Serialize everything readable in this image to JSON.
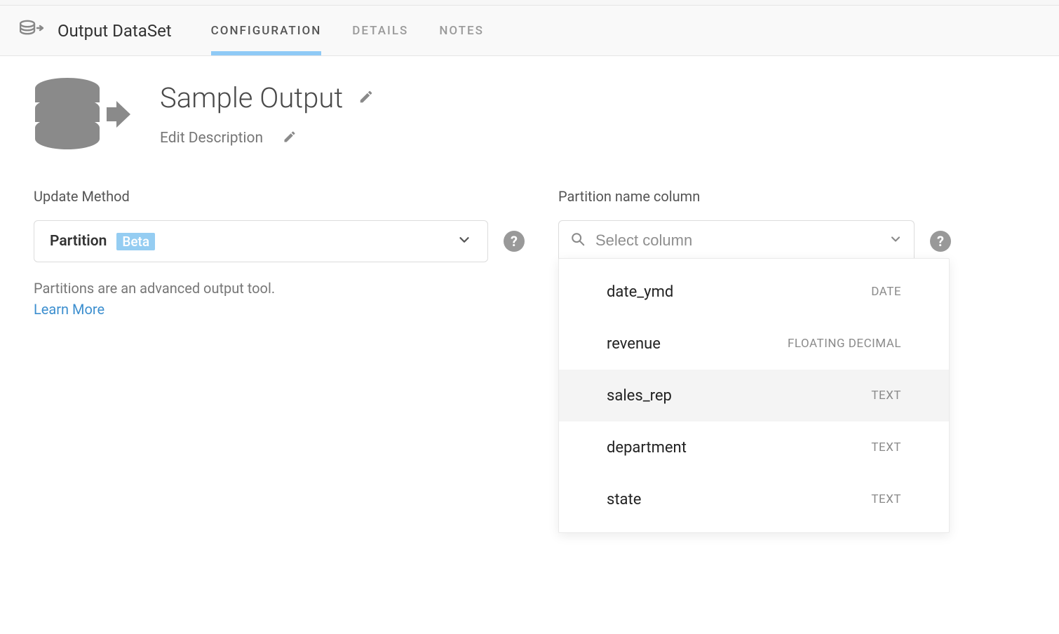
{
  "header": {
    "title": "Output DataSet",
    "tabs": [
      {
        "label": "CONFIGURATION",
        "active": true
      },
      {
        "label": "DETAILS",
        "active": false
      },
      {
        "label": "NOTES",
        "active": false
      }
    ]
  },
  "dataset": {
    "title": "Sample Output",
    "description_placeholder": "Edit Description"
  },
  "update_method": {
    "label": "Update Method",
    "value": "Partition",
    "badge": "Beta",
    "helper": "Partitions are an advanced output tool.",
    "learn_more": "Learn More"
  },
  "partition_column": {
    "label": "Partition name column",
    "placeholder": "Select column",
    "options": [
      {
        "name": "date_ymd",
        "type": "DATE"
      },
      {
        "name": "revenue",
        "type": "FLOATING DECIMAL"
      },
      {
        "name": "sales_rep",
        "type": "TEXT",
        "hover": true
      },
      {
        "name": "department",
        "type": "TEXT"
      },
      {
        "name": "state",
        "type": "TEXT"
      }
    ]
  }
}
